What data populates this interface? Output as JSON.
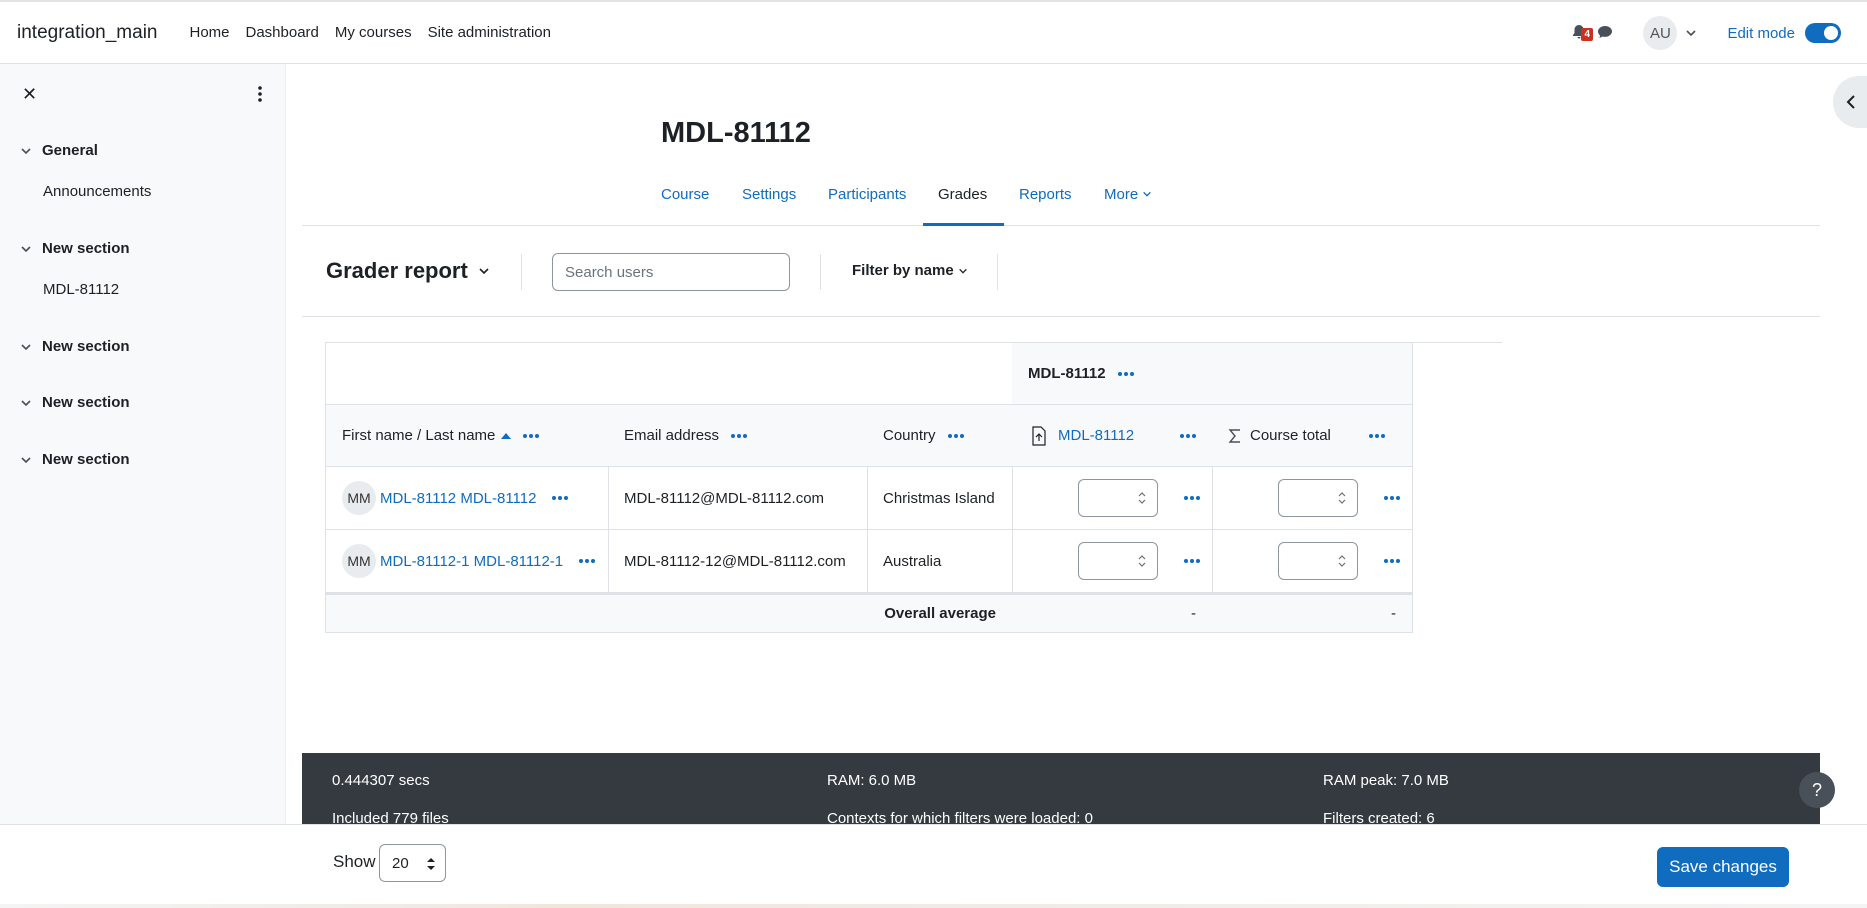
{
  "navbar": {
    "brand": "integration_main",
    "links": [
      "Home",
      "Dashboard",
      "My courses",
      "Site administration"
    ],
    "notification_count": "4",
    "user_initials": "AU",
    "edit_mode_label": "Edit mode",
    "edit_mode_on": true
  },
  "drawer": {
    "sections": [
      {
        "title": "General",
        "items": [
          "Announcements"
        ]
      },
      {
        "title": "New section",
        "items": [
          "MDL-81112"
        ]
      },
      {
        "title": "New section",
        "items": []
      },
      {
        "title": "New section",
        "items": []
      },
      {
        "title": "New section",
        "items": []
      }
    ]
  },
  "page": {
    "title": "MDL-81112",
    "tabs": [
      "Course",
      "Settings",
      "Participants",
      "Grades",
      "Reports",
      "More"
    ],
    "active_tab": "Grades"
  },
  "tertiary": {
    "report_title": "Grader report",
    "search_placeholder": "Search users",
    "filter_label": "Filter by name"
  },
  "grader": {
    "category_header": "MDL-81112",
    "columns": {
      "name": "First name / Last name",
      "email": "Email address",
      "country": "Country",
      "item": "MDL-81112",
      "total": "Course total"
    },
    "rows": [
      {
        "initials": "MM",
        "name": "MDL-81112 MDL-81112",
        "email": "MDL-81112@MDL-81112.com",
        "country": "Christmas Island"
      },
      {
        "initials": "MM",
        "name": "MDL-81112-1 MDL-81112-1",
        "email": "MDL-81112-12@MDL-81112.com",
        "country": "Australia"
      }
    ],
    "average_label": "Overall average",
    "average_item": "-",
    "average_total": "-"
  },
  "perf": {
    "col1": [
      "0.444307 secs",
      "Included 779 files"
    ],
    "col2": [
      "RAM: 6.0 MB",
      "Contexts for which filters were loaded: 0"
    ],
    "col3": [
      "RAM peak: 7.0 MB",
      "Filters created: 6"
    ]
  },
  "footer": {
    "show_label": "Show",
    "show_value": "20",
    "save_label": "Save changes"
  },
  "icons": [
    "bell-icon",
    "chat-icon",
    "chevron-down-icon",
    "close-icon",
    "kebab-icon",
    "chevron-left-icon",
    "assignment-icon",
    "sigma-icon",
    "help-icon"
  ],
  "colors": {
    "accent": "#0f6cbf",
    "footer_bg": "#343a40",
    "badge": "#ca3120"
  }
}
